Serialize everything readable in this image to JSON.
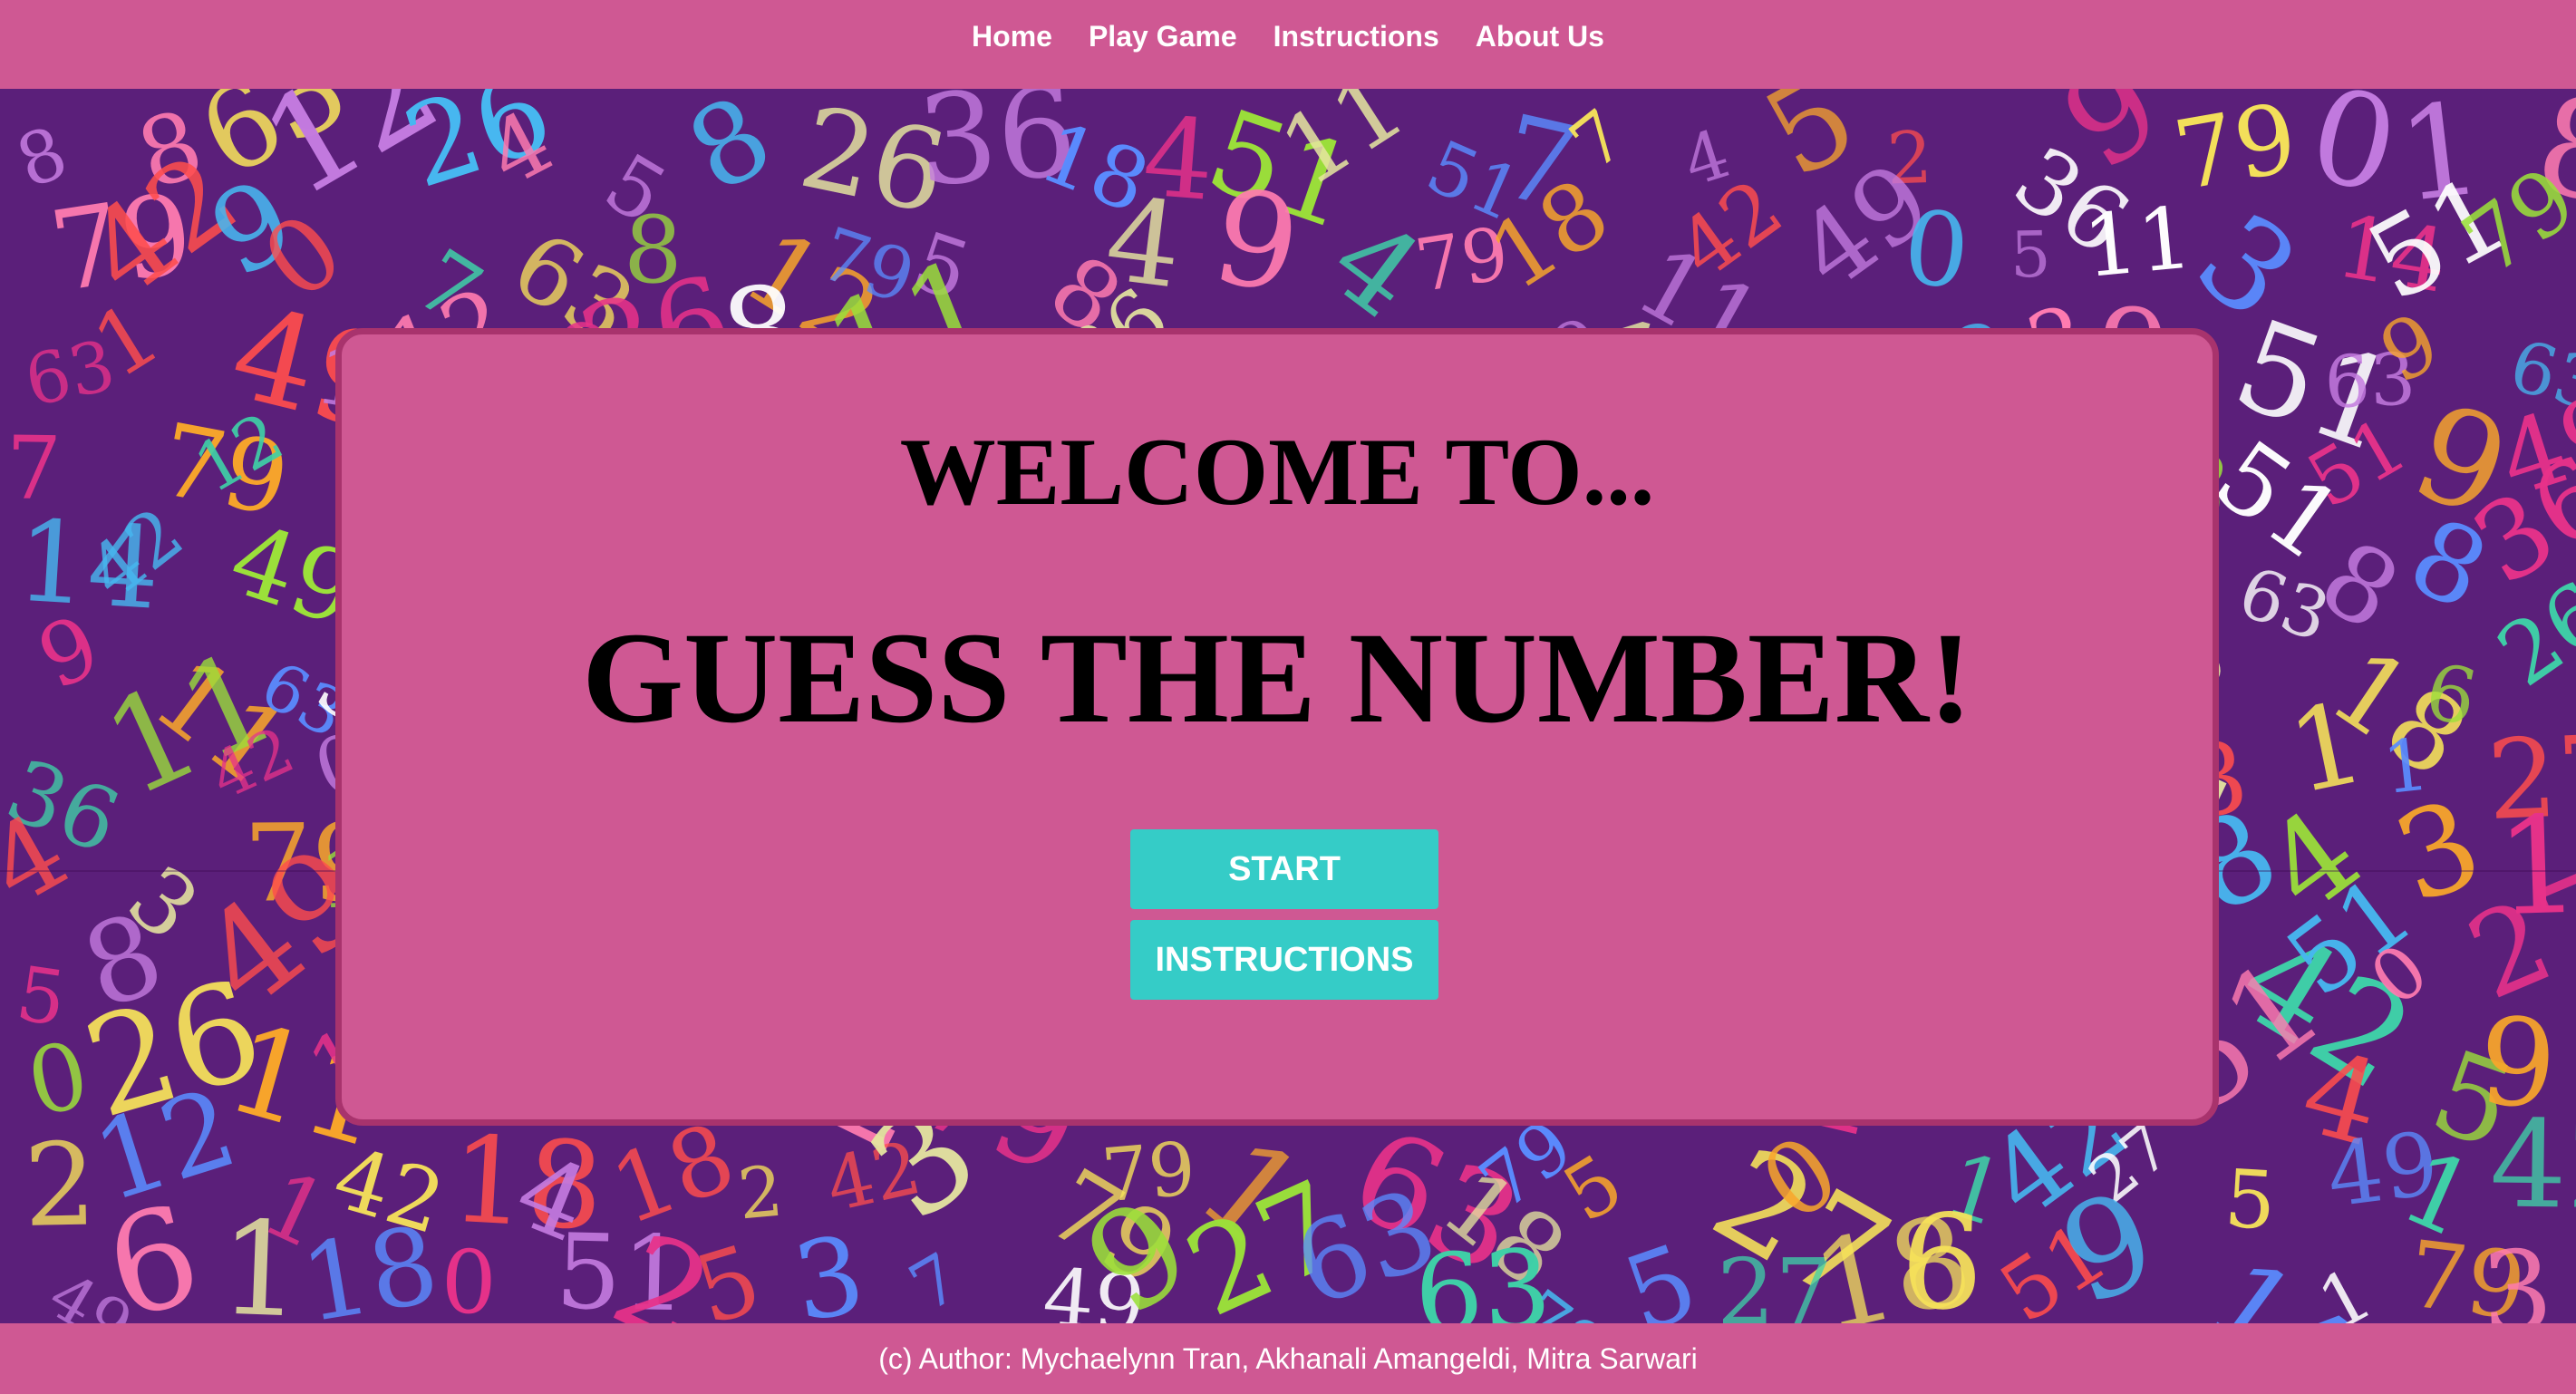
{
  "nav": {
    "links": [
      {
        "label": "Home"
      },
      {
        "label": "Play Game"
      },
      {
        "label": "Instructions"
      },
      {
        "label": "About Us"
      }
    ]
  },
  "hero": {
    "welcome": "WELCOME TO...",
    "title": "GUESS THE NUMBER!",
    "start_label": "START",
    "instructions_label": "INSTRUCTIONS"
  },
  "footer": {
    "text": "(c) Author: Mychaelynn Tran, Akhanali Amangeldi, Mitra Sarwari"
  },
  "colors": {
    "page_bg": "#cf5893",
    "card_border": "#a8336d",
    "button_bg": "#35ccc7",
    "pattern_bg": "#5b1f7a"
  },
  "background": {
    "digits": [
      "51",
      "8",
      "27",
      "63",
      "12",
      "36",
      "9",
      "4",
      "14",
      "26",
      "49",
      "79",
      "3",
      "5",
      "0",
      "6",
      "2",
      "1",
      "7",
      "11",
      "18",
      "42"
    ],
    "digit_colors": [
      "#e8328a",
      "#f9a62b",
      "#47b7f0",
      "#9be03a",
      "#ff4d4d",
      "#c47be0",
      "#f7e35a",
      "#3fd1a8",
      "#ffffff",
      "#ff7bb0",
      "#5a8cff",
      "#e6e6a0"
    ]
  }
}
